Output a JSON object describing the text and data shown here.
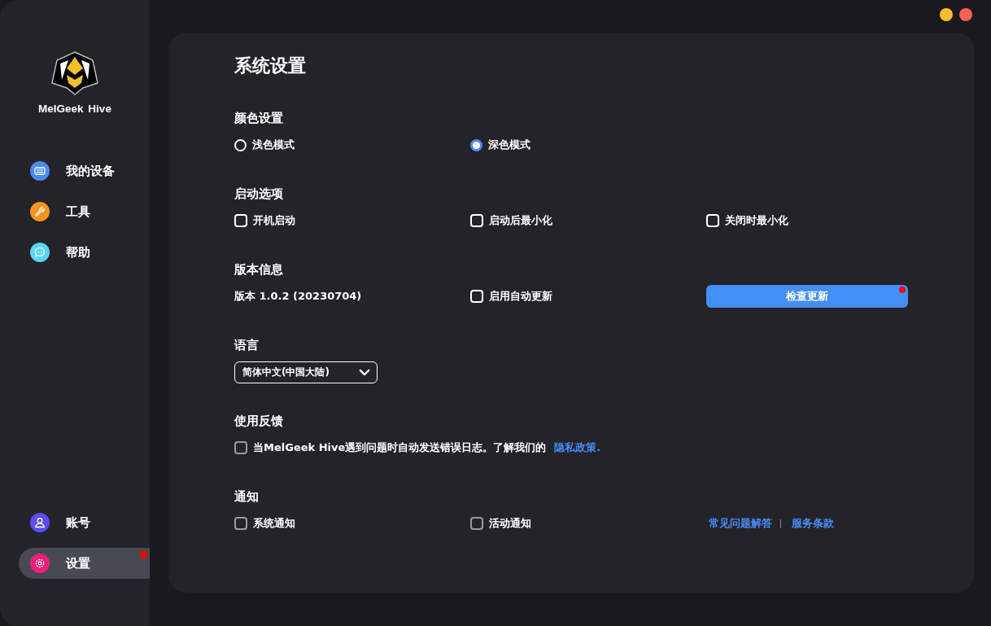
{
  "app": {
    "name": "MelGeek Hive"
  },
  "window_controls": [
    {
      "kind": "minimize"
    },
    {
      "kind": "close"
    }
  ],
  "sidebar": {
    "items": [
      {
        "label": "我的设备",
        "kind": "keyboard",
        "color": "#4a8cf7",
        "selected": false,
        "badge": false
      },
      {
        "label": "工具",
        "kind": "wrench",
        "color": "#f7931e",
        "selected": false,
        "badge": false
      },
      {
        "label": "帮助",
        "kind": "chat",
        "color": "#5ad4f5",
        "selected": false,
        "badge": false
      }
    ],
    "bottom_items": [
      {
        "label": "账号",
        "kind": "user",
        "color": "#5b4cf5",
        "selected": false,
        "badge": false
      },
      {
        "label": "设置",
        "kind": "gear",
        "color": "#f0207a",
        "selected": true,
        "badge": true
      }
    ]
  },
  "page": {
    "title": "系统设置",
    "sections": [
      {
        "title": "颜色设置",
        "items": [
          {
            "kind": "radio",
            "label": "浅色模式",
            "selected": false
          },
          {
            "kind": "radio",
            "label": "深色模式",
            "selected": true
          }
        ]
      },
      {
        "title": "启动选项",
        "items": [
          {
            "kind": "checkbox",
            "label": "开机启动",
            "checked": false,
            "disabled": false
          },
          {
            "kind": "checkbox",
            "label": "启动后最小化",
            "checked": false,
            "disabled": false
          },
          {
            "kind": "checkbox",
            "label": "关闭时最小化",
            "checked": false,
            "disabled": false
          }
        ]
      },
      {
        "title": "版本信息",
        "items": [
          {
            "kind": "text",
            "text": "版本 1.0.2 (20230704)"
          },
          {
            "kind": "checkbox",
            "label": "启用自动更新",
            "checked": false,
            "disabled": false
          },
          {
            "kind": "button",
            "label": "检查更新",
            "badge": true
          }
        ]
      },
      {
        "title": "语言",
        "items": [
          {
            "kind": "select",
            "value": "简体中文(中国大陆)"
          }
        ]
      },
      {
        "title": "使用反馈",
        "items": [
          {
            "kind": "consent",
            "label": "当MelGeek Hive遇到问题时自动发送错误日志。了解我们的",
            "link": "隐私政策.",
            "checked": false,
            "disabled": true
          }
        ]
      },
      {
        "title": "通知",
        "items": [
          {
            "kind": "checkbox",
            "label": "系统通知",
            "checked": false,
            "disabled": true
          },
          {
            "kind": "checkbox",
            "label": "活动通知",
            "checked": false,
            "disabled": true
          },
          {
            "kind": "links",
            "links": [
              "常见问题解答",
              "服务条款"
            ]
          }
        ]
      }
    ]
  }
}
